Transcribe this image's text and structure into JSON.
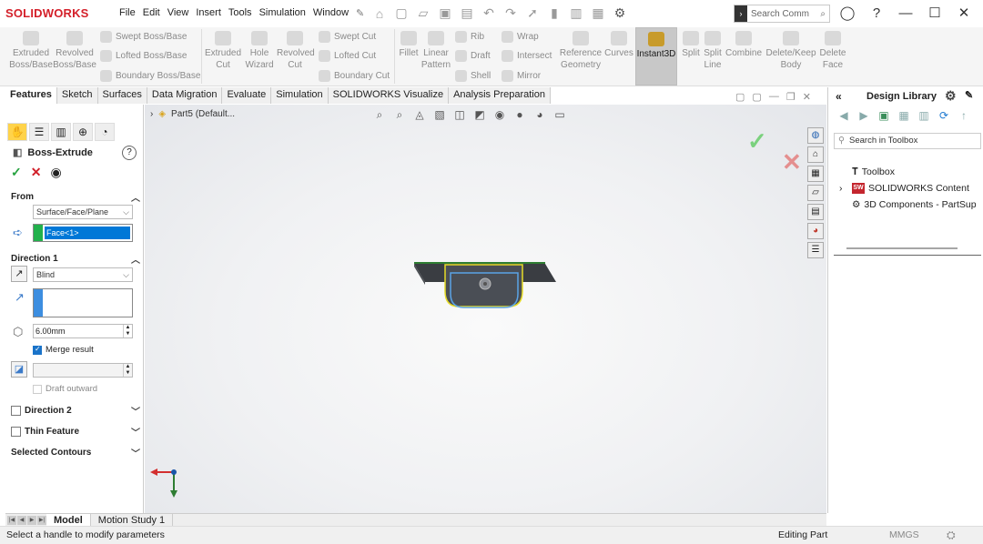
{
  "app": {
    "logo": "SOLIDWORKS"
  },
  "menu": [
    "File",
    "Edit",
    "View",
    "Insert",
    "Tools",
    "Simulation",
    "Window"
  ],
  "search": {
    "placeholder": "Search Comm"
  },
  "ribbon": {
    "extruded_boss": "Extruded\nBoss/Base",
    "revolved_boss": "Revolved\nBoss/Base",
    "swept_boss": "Swept Boss/Base",
    "lofted_boss": "Lofted Boss/Base",
    "boundary_boss": "Boundary Boss/Base",
    "extruded_cut": "Extruded\nCut",
    "hole_wizard": "Hole\nWizard",
    "revolved_cut": "Revolved\nCut",
    "swept_cut": "Swept Cut",
    "lofted_cut": "Lofted Cut",
    "boundary_cut": "Boundary Cut",
    "fillet": "Fillet",
    "linear_pattern": "Linear\nPattern",
    "rib": "Rib",
    "draft": "Draft",
    "shell": "Shell",
    "wrap": "Wrap",
    "intersect": "Intersect",
    "mirror": "Mirror",
    "reference_geometry": "Reference\nGeometry",
    "curves": "Curves",
    "instant3d": "Instant3D",
    "split": "Split",
    "split_line": "Split\nLine",
    "combine": "Combine",
    "delete_keep_body": "Delete/Keep\nBody",
    "delete_face": "Delete\nFace"
  },
  "tabs": [
    "Features",
    "Sketch",
    "Surfaces",
    "Data Migration",
    "Evaluate",
    "Simulation",
    "SOLIDWORKS Visualize",
    "Analysis Preparation"
  ],
  "property_manager": {
    "title": "Boss-Extrude",
    "help": "?",
    "from_label": "From",
    "from_value": "Surface/Face/Plane",
    "face_value": "Face<1>",
    "direction1_label": "Direction 1",
    "end_condition": "Blind",
    "depth": "6.00mm",
    "merge_result": "Merge result",
    "draft_outward": "Draft outward",
    "direction2_label": "Direction 2",
    "thin_feature_label": "Thin Feature",
    "selected_contours_label": "Selected Contours"
  },
  "viewport": {
    "part_name": "Part5 (Default..."
  },
  "design_library": {
    "title": "Design Library",
    "search_placeholder": "Search in Toolbox",
    "items": [
      "Toolbox",
      "SOLIDWORKS Content",
      "3D Components - PartSup"
    ]
  },
  "bottom_tabs": [
    "Model",
    "Motion Study 1"
  ],
  "status": {
    "message": "Select a handle to modify parameters",
    "mode": "Editing Part",
    "units": "MMGS"
  },
  "colors": {
    "brand": "#d4202a",
    "ok": "#27a340",
    "cancel": "#d1202a",
    "selection": "#0078d7"
  }
}
